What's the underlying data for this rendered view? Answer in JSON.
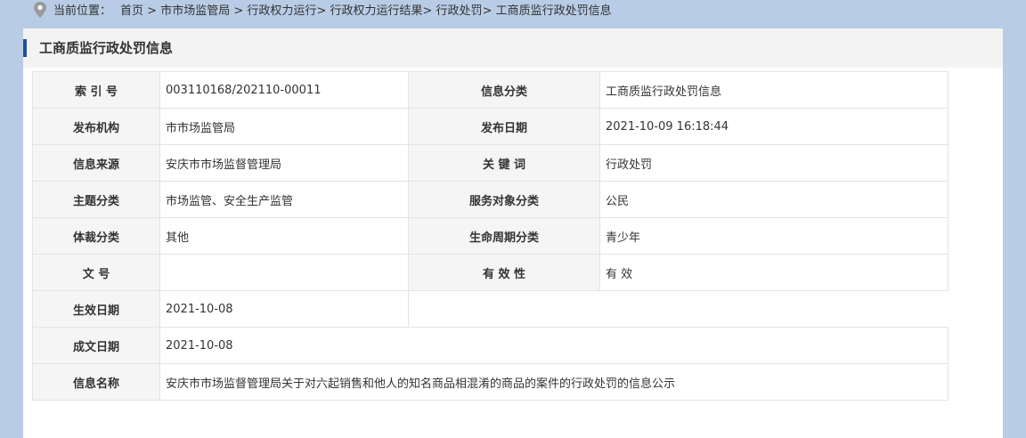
{
  "breadcrumb": {
    "lead": "当前位置：",
    "items": [
      "首页",
      "市市场监管局",
      "行政权力运行",
      "行政权力运行结果",
      "行政处罚",
      "工商质监行政处罚信息"
    ],
    "separators": [
      ">",
      ">",
      ">",
      ">",
      ">"
    ]
  },
  "panel": {
    "title": "工商质监行政处罚信息"
  },
  "info": {
    "index_no_label": "索 引 号",
    "index_no": "003110168/202110-00011",
    "category_label": "信息分类",
    "category": "工商质监行政处罚信息",
    "publisher_label": "发布机构",
    "publisher": "市市场监管局",
    "publish_date_label": "发布日期",
    "publish_date": "2021-10-09 16:18:44",
    "source_label": "信息来源",
    "source": "安庆市市场监督管理局",
    "keywords_label": "关 键 词",
    "keywords": "行政处罚",
    "topic_label": "主题分类",
    "topic": "市场监管、安全生产监管",
    "audience_label": "服务对象分类",
    "audience": "公民",
    "genre_label": "体裁分类",
    "genre": "其他",
    "lifecycle_label": "生命周期分类",
    "lifecycle": "青少年",
    "doc_no_label": "文 号",
    "doc_no": "",
    "validity_label": "有 效 性",
    "validity": "有 效",
    "effective_date_label": "生效日期",
    "effective_date": "2021-10-08",
    "written_date_label": "成文日期",
    "written_date": "2021-10-08",
    "name_label": "信息名称",
    "name": "安庆市市场监督管理局关于对六起销售和他人的知名商品相混淆的商品的案件的行政处罚的信息公示"
  }
}
